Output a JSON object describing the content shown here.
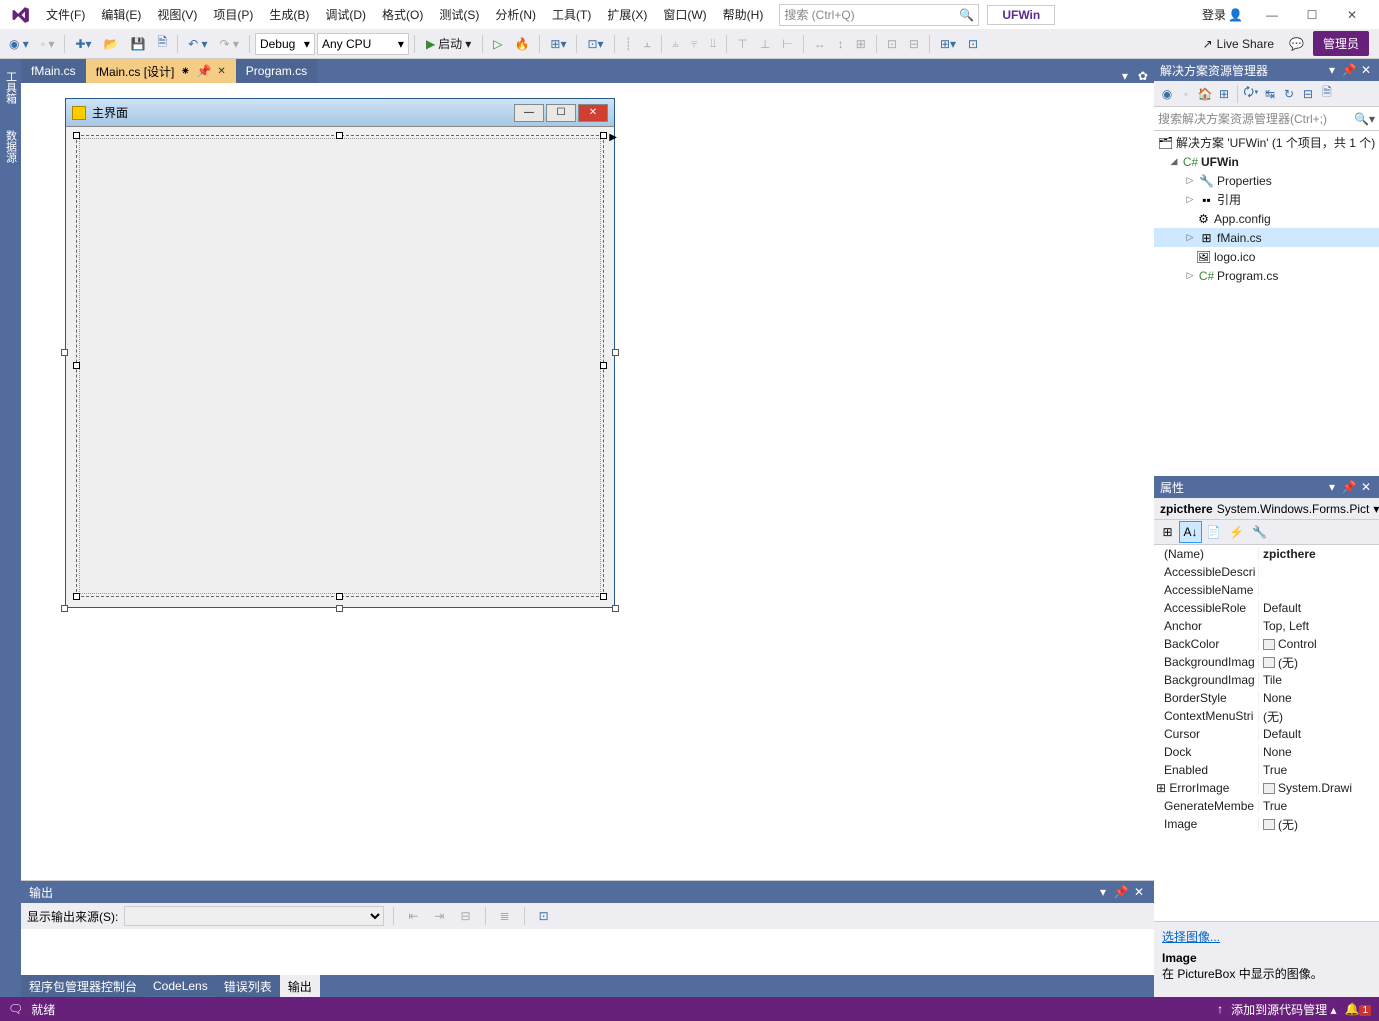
{
  "menu": {
    "items": [
      "文件(F)",
      "编辑(E)",
      "视图(V)",
      "项目(P)",
      "生成(B)",
      "调试(D)",
      "格式(O)",
      "测试(S)",
      "分析(N)",
      "工具(T)",
      "扩展(X)",
      "窗口(W)",
      "帮助(H)"
    ]
  },
  "search": {
    "placeholder": "搜索 (Ctrl+Q)"
  },
  "project_badge": "UFWin",
  "login": "登录",
  "toolbar": {
    "config": "Debug",
    "platform": "Any CPU",
    "start": "启动",
    "liveshare": "Live Share",
    "admin": "管理员"
  },
  "rail": [
    "工具箱",
    "数据源"
  ],
  "doc_tabs": [
    {
      "label": "fMain.cs",
      "active": false
    },
    {
      "label": "fMain.cs [设计]",
      "active": true,
      "dirty": "⁕"
    },
    {
      "label": "Program.cs",
      "active": false
    }
  ],
  "form": {
    "title": "主界面"
  },
  "output": {
    "title": "输出",
    "source_label": "显示输出来源(S):"
  },
  "bottom_tabs": [
    "程序包管理器控制台",
    "CodeLens",
    "错误列表",
    "输出"
  ],
  "se": {
    "title": "解决方案资源管理器",
    "search_ph": "搜索解决方案资源管理器(Ctrl+;)",
    "sol": "解决方案 'UFWin' (1 个项目，共 1 个)",
    "proj": "UFWin",
    "nodes": [
      "Properties",
      "引用",
      "App.config",
      "fMain.cs",
      "logo.ico",
      "Program.cs"
    ]
  },
  "props": {
    "title": "属性",
    "obj_name": "zpicthere",
    "obj_type": "System.Windows.Forms.Pict",
    "rows": [
      {
        "n": "(Name)",
        "v": "zpicthere",
        "b": true
      },
      {
        "n": "AccessibleDescri",
        "v": ""
      },
      {
        "n": "AccessibleName",
        "v": ""
      },
      {
        "n": "AccessibleRole",
        "v": "Default"
      },
      {
        "n": "Anchor",
        "v": "Top, Left"
      },
      {
        "n": "BackColor",
        "v": "Control",
        "sw": true
      },
      {
        "n": "BackgroundImag",
        "v": "(无)",
        "sw": true
      },
      {
        "n": "BackgroundImag",
        "v": "Tile"
      },
      {
        "n": "BorderStyle",
        "v": "None"
      },
      {
        "n": "ContextMenuStri",
        "v": "(无)"
      },
      {
        "n": "Cursor",
        "v": "Default"
      },
      {
        "n": "Dock",
        "v": "None"
      },
      {
        "n": "Enabled",
        "v": "True"
      },
      {
        "n": "ErrorImage",
        "v": "System.Drawi",
        "sw": true,
        "exp": true
      },
      {
        "n": "GenerateMembe",
        "v": "True"
      },
      {
        "n": "Image",
        "v": "(无)",
        "sw": true
      }
    ],
    "link": "选择图像...",
    "desc_h": "Image",
    "desc_t": "在 PictureBox 中显示的图像。"
  },
  "status": {
    "ready": "就绪",
    "scm": "添加到源代码管理",
    "notif": "1"
  }
}
